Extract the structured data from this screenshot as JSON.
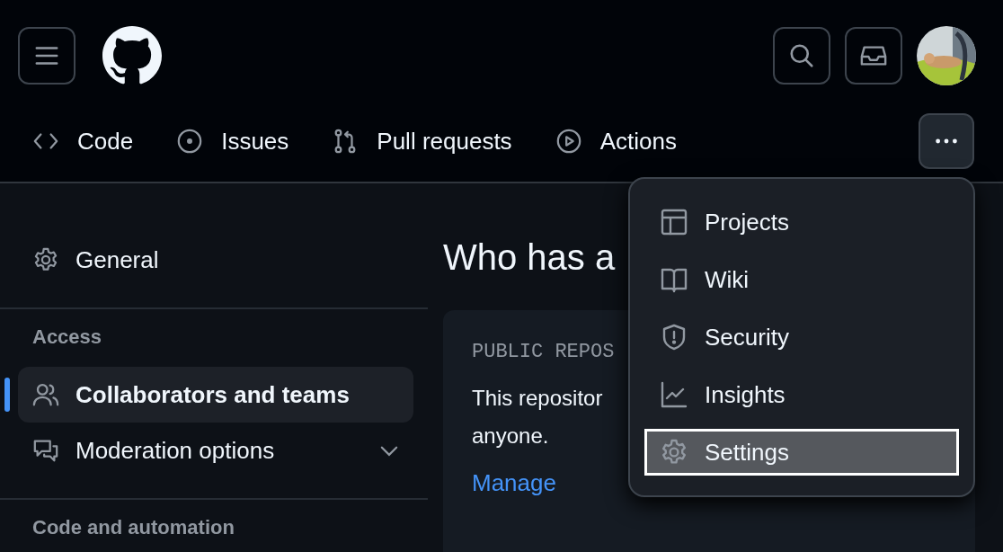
{
  "header": {
    "tabs": [
      {
        "label": "Code"
      },
      {
        "label": "Issues"
      },
      {
        "label": "Pull requests"
      },
      {
        "label": "Actions"
      }
    ]
  },
  "sidebar": {
    "items": [
      {
        "label": "General",
        "selected": false
      }
    ],
    "sections": [
      {
        "heading": "Access",
        "items": [
          {
            "label": "Collaborators and teams",
            "selected": true
          },
          {
            "label": "Moderation options",
            "selected": false,
            "expanded": false
          }
        ]
      },
      {
        "heading": "Code and automation"
      }
    ]
  },
  "main": {
    "title": "Who has a",
    "card": {
      "label": "PUBLIC REPOS",
      "lines": [
        "This repositor",
        "anyone."
      ],
      "link": "Manage"
    }
  },
  "more_menu": {
    "items": [
      {
        "label": "Projects",
        "selected": false
      },
      {
        "label": "Wiki",
        "selected": false
      },
      {
        "label": "Security",
        "selected": false
      },
      {
        "label": "Insights",
        "selected": false
      },
      {
        "label": "Settings",
        "selected": true
      }
    ]
  }
}
